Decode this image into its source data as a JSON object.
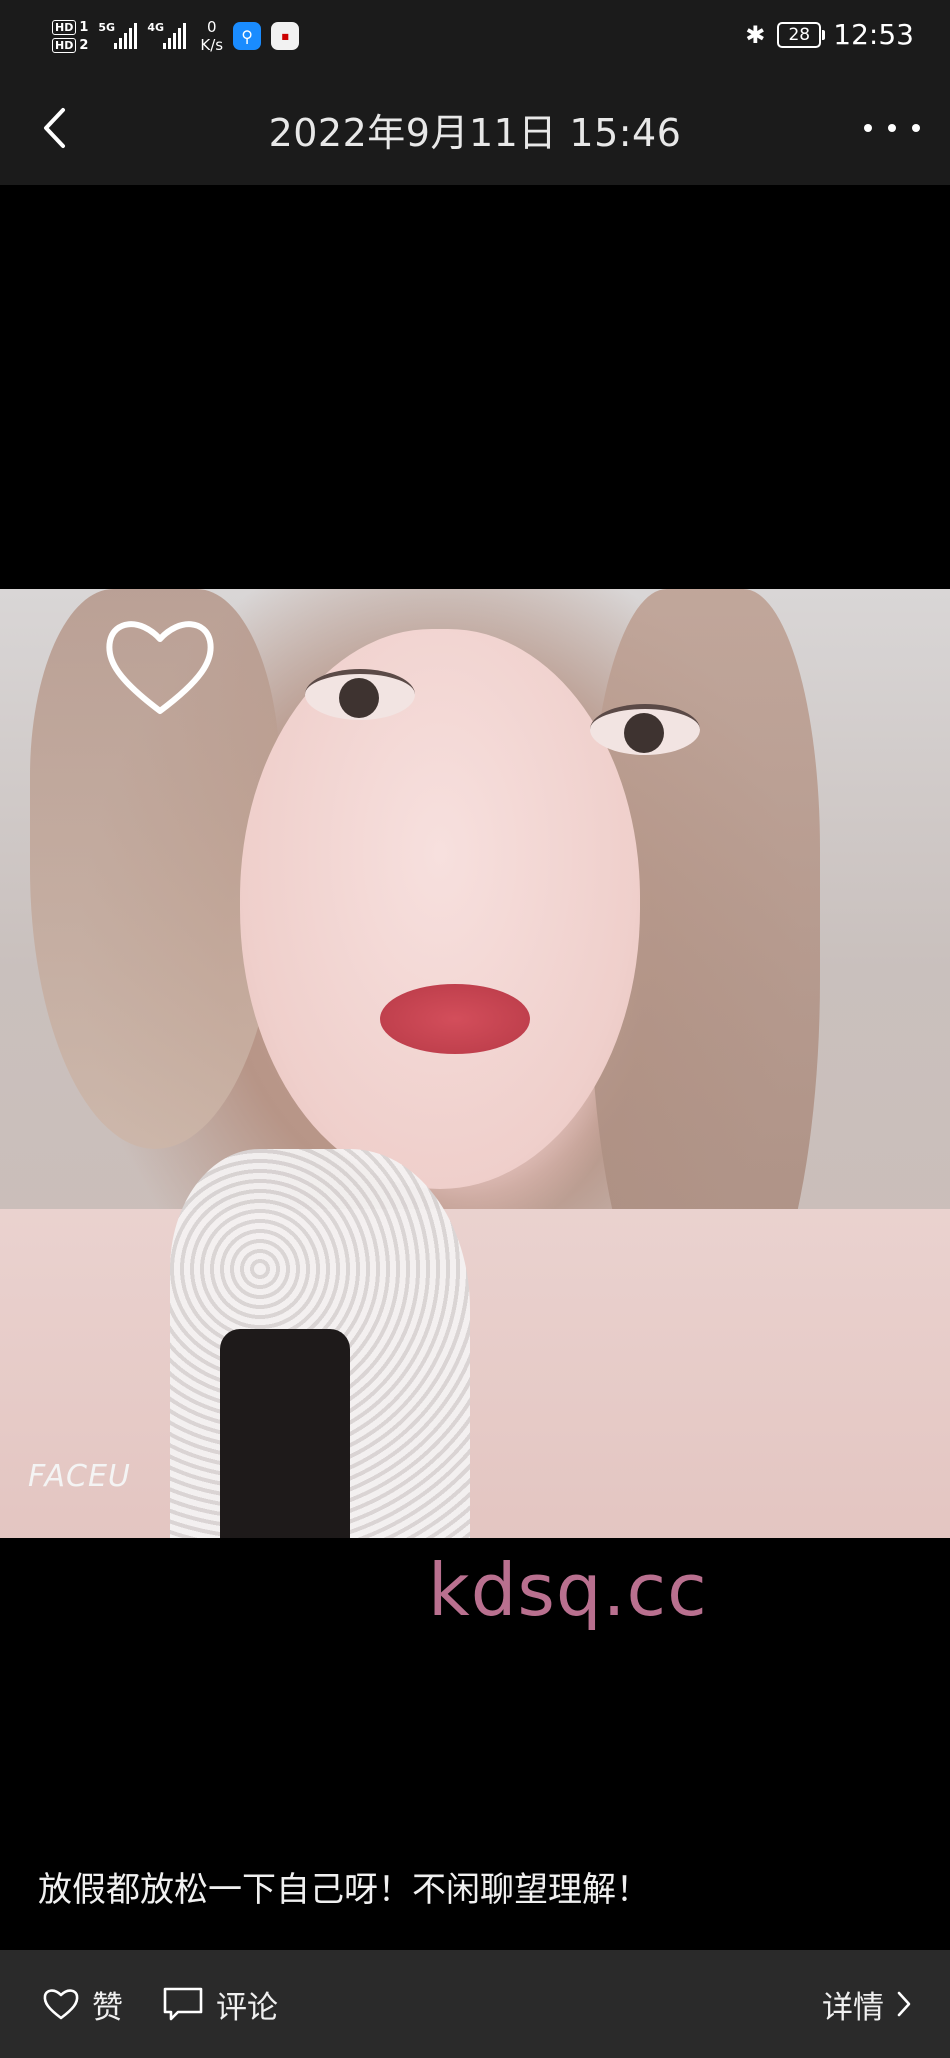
{
  "status_bar": {
    "hd1": "HD",
    "hd1_num": "1",
    "hd2": "HD",
    "hd2_num": "2",
    "net1": "5G",
    "net2": "4G",
    "speed_value": "0",
    "speed_unit": "K/s",
    "battery": "28",
    "time": "12:53"
  },
  "header": {
    "title": "2022年9月11日 15:46"
  },
  "photo": {
    "sticker_text": "FACEU"
  },
  "watermark": "kdsq.cc",
  "caption": "放假都放松一下自己呀！不闲聊望理解！",
  "actions": {
    "like_label": "赞",
    "comment_label": "评论",
    "detail_label": "详情"
  },
  "icons": {
    "back": "chevron-left-icon",
    "more": "more-dots-icon",
    "like": "heart-outline-icon",
    "comment": "comment-icon",
    "detail": "chevron-right-icon"
  }
}
